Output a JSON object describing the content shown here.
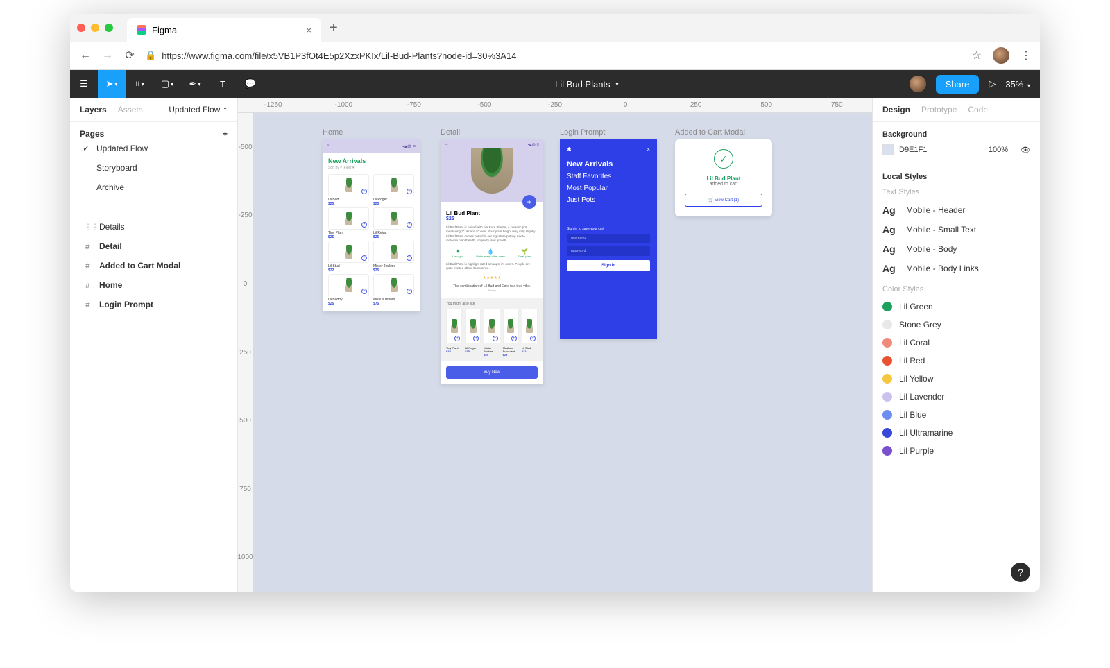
{
  "browser": {
    "tab_title": "Figma",
    "url": "https://www.figma.com/file/x5VB1P3fOt4E5p2XzxPKIx/Lil-Bud-Plants?node-id=30%3A14"
  },
  "toolbar": {
    "doc_title": "Lil Bud Plants",
    "share_label": "Share",
    "zoom": "35%"
  },
  "ruler_h": [
    "-1250",
    "-1000",
    "-750",
    "-500",
    "-250",
    "0",
    "250",
    "500",
    "750"
  ],
  "ruler_v": [
    "-500",
    "-250",
    "0",
    "250",
    "500",
    "750",
    "1000"
  ],
  "left_panel": {
    "tabs": {
      "layers": "Layers",
      "assets": "Assets",
      "page_name": "Updated Flow"
    },
    "pages_label": "Pages",
    "pages": [
      {
        "name": "Updated Flow",
        "selected": true
      },
      {
        "name": "Storyboard",
        "selected": false
      },
      {
        "name": "Archive",
        "selected": false
      }
    ],
    "layers": [
      {
        "name": "Details",
        "type": "dotted",
        "bold": false
      },
      {
        "name": "Detail",
        "type": "frame",
        "bold": true
      },
      {
        "name": "Added to Cart Modal",
        "type": "frame",
        "bold": true
      },
      {
        "name": "Home",
        "type": "frame",
        "bold": true
      },
      {
        "name": "Login Prompt",
        "type": "frame",
        "bold": true
      }
    ]
  },
  "frames": {
    "home": {
      "label": "Home",
      "title": "New Arrivals",
      "sort": "Sort by ▾",
      "filter": "Filter ▾",
      "products": [
        {
          "name": "Lil Bud",
          "price": "$25"
        },
        {
          "name": "Lil Roger",
          "price": "$25"
        },
        {
          "name": "Tiny Plant",
          "price": "$25"
        },
        {
          "name": "Lil Reina",
          "price": "$25"
        },
        {
          "name": "Lil Stud",
          "price": "$22"
        },
        {
          "name": "Mister Jenkins",
          "price": "$25"
        },
        {
          "name": "Lil Buddy",
          "price": "$25"
        },
        {
          "name": "Missus Bloom",
          "price": "$75"
        }
      ]
    },
    "detail": {
      "label": "Detail",
      "name": "Lil Bud Plant",
      "price": "$25",
      "desc": "Lil Bud Plant is paired with our Eore Planter, a ceramic pot measuring 3\" tall and 5\" wide. Your plant height may vary slightly. Lil Bud Plant comes potted in our signature potting mix to increase plant health, longevity, and growth.",
      "care": [
        {
          "icon": "☀",
          "label": "Low light"
        },
        {
          "icon": "💧",
          "label": "Water every other week"
        },
        {
          "icon": "🌱",
          "label": "Small plant"
        }
      ],
      "review_intro": "Lil Bud Plant is highlight rated amongst it's peers. People are quite excited about its essence.",
      "quote": "The combination of Lil Bud and Eore is a true vibe.",
      "author": "Tracey",
      "related_label": "You might also like",
      "related": [
        {
          "name": "Tiny Plant",
          "price": "$25"
        },
        {
          "name": "Lil Roger",
          "price": "$25"
        },
        {
          "name": "Mister Jenkins",
          "price": "$25"
        },
        {
          "name": "Medium Succulent",
          "price": "$25"
        },
        {
          "name": "Lil Stud",
          "price": "$22"
        }
      ],
      "buy_label": "Buy Now"
    },
    "login": {
      "label": "Login Prompt",
      "nav": [
        "New Arrivals",
        "Staff Favorites",
        "Most Popular",
        "Just Pots"
      ],
      "signin_label": "Sign in to save your cart",
      "username": "username",
      "password": "password",
      "button": "Sign in"
    },
    "cart": {
      "label": "Added to Cart Modal",
      "name": "Lil Bud Plant",
      "sub": "added to cart",
      "button": "🛒 View Cart (1)"
    }
  },
  "right_panel": {
    "tabs": {
      "design": "Design",
      "prototype": "Prototype",
      "code": "Code"
    },
    "background_label": "Background",
    "bg_hex": "D9E1F1",
    "bg_opacity": "100%",
    "local_styles_label": "Local Styles",
    "text_styles_label": "Text Styles",
    "text_styles": [
      "Mobile - Header",
      "Mobile - Small Text",
      "Mobile - Body",
      "Mobile - Body Links"
    ],
    "color_styles_label": "Color Styles",
    "color_styles": [
      {
        "name": "Lil Green",
        "hex": "#1aa15d"
      },
      {
        "name": "Stone Grey",
        "hex": "#e8e8e8"
      },
      {
        "name": "Lil Coral",
        "hex": "#f08a7a"
      },
      {
        "name": "Lil Red",
        "hex": "#e8522e"
      },
      {
        "name": "Lil Yellow",
        "hex": "#f5c842"
      },
      {
        "name": "Lil Lavender",
        "hex": "#cbc3ed"
      },
      {
        "name": "Lil Blue",
        "hex": "#6b8ef0"
      },
      {
        "name": "Lil Ultramarine",
        "hex": "#3848d8"
      },
      {
        "name": "Lil Purple",
        "hex": "#7a4fd0"
      }
    ]
  }
}
